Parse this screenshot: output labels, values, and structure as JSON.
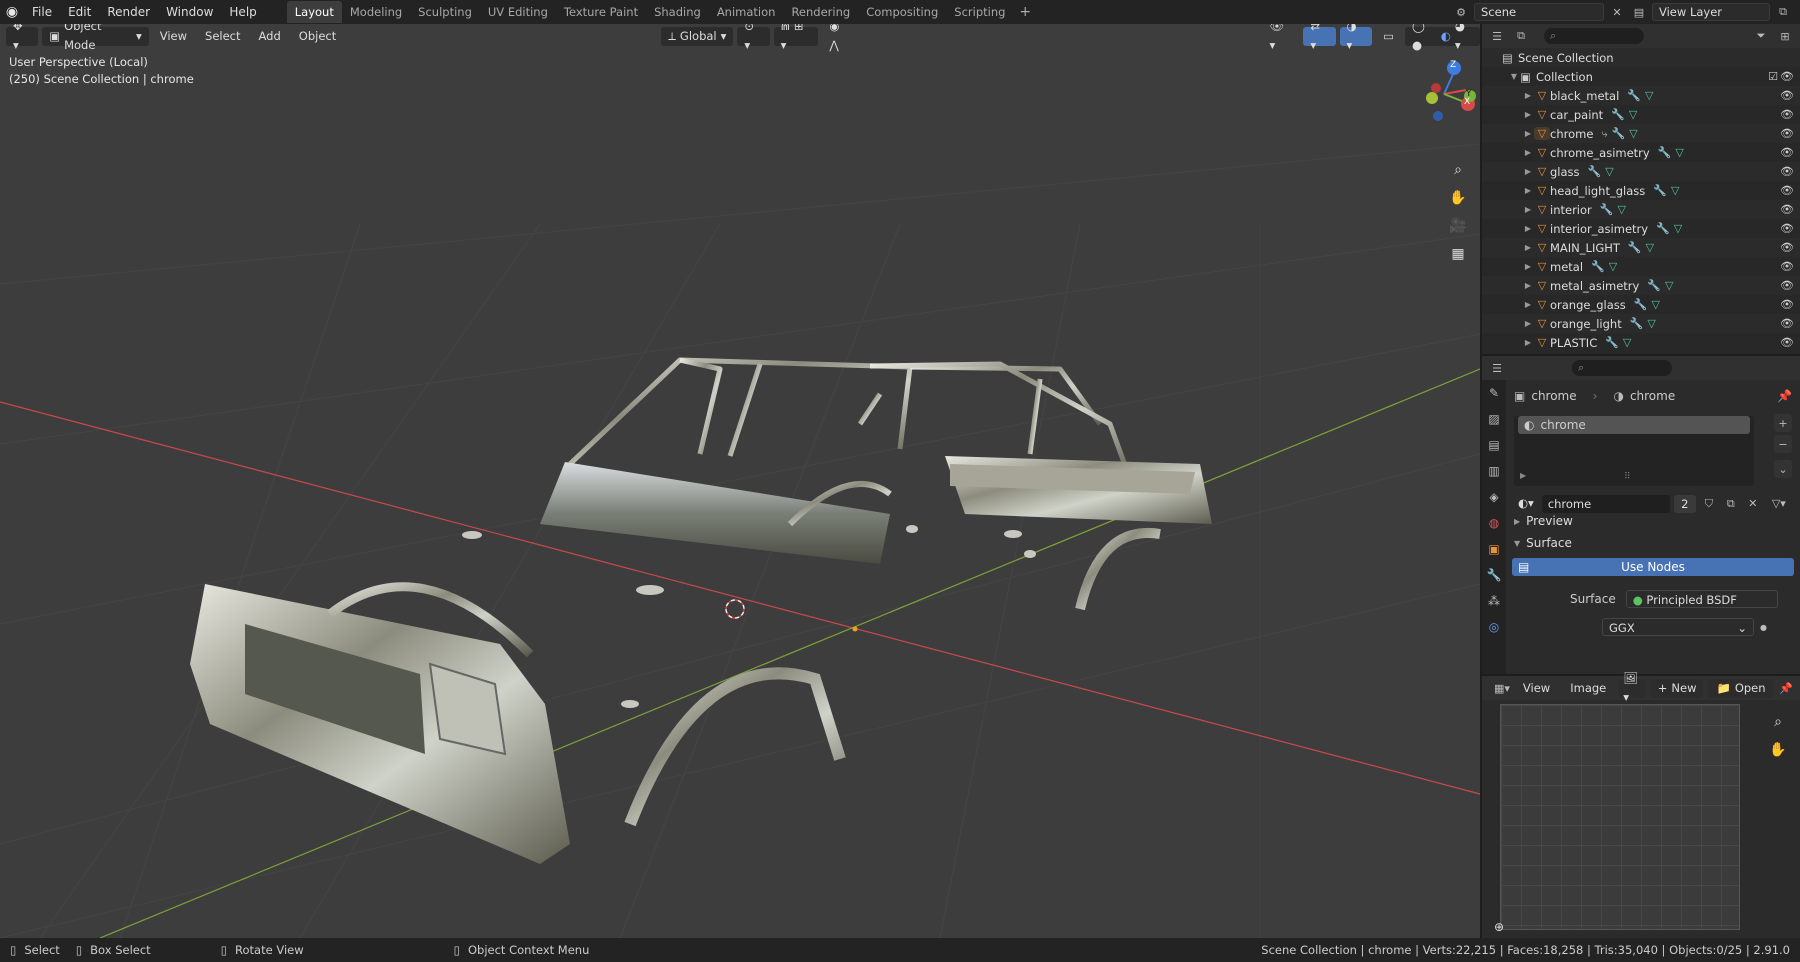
{
  "topbar": {
    "menus": [
      "File",
      "Edit",
      "Render",
      "Window",
      "Help"
    ],
    "tabs": [
      "Layout",
      "Modeling",
      "Sculpting",
      "UV Editing",
      "Texture Paint",
      "Shading",
      "Animation",
      "Rendering",
      "Compositing",
      "Scripting"
    ],
    "active_tab": "Layout",
    "scene": "Scene",
    "view_layer": "View Layer"
  },
  "viewport": {
    "mode": "Object Mode",
    "menus": [
      "View",
      "Select",
      "Add",
      "Object"
    ],
    "transform_orientation": "Global",
    "info_line1": "User Perspective (Local)",
    "info_line2": "(250) Scene Collection | chrome",
    "gizmo": {
      "x": "X",
      "y": "Y",
      "z": "Z"
    }
  },
  "outliner": {
    "root": "Scene Collection",
    "collection": "Collection",
    "items": [
      "black_metal",
      "car_paint",
      "chrome",
      "chrome_asimetry",
      "glass",
      "head_light_glass",
      "interior",
      "interior_asimetry",
      "MAIN_LIGHT",
      "metal",
      "metal_asimetry",
      "orange_glass",
      "orange_light",
      "PLASTIC"
    ]
  },
  "properties": {
    "object_name": "chrome",
    "material_name": "chrome",
    "slot_name": "chrome",
    "material_field": "chrome",
    "user_count": "2",
    "section_preview": "Preview",
    "section_surface": "Surface",
    "use_nodes_label": "Use Nodes",
    "surface_label": "Surface",
    "surface_value": "Principled BSDF",
    "distribution": "GGX"
  },
  "image_editor": {
    "menus": [
      "View",
      "Image"
    ],
    "new_label": "New",
    "open_label": "Open"
  },
  "statusbar": {
    "select": "Select",
    "box_select": "Box Select",
    "rotate_view": "Rotate View",
    "context_menu": "Object Context Menu",
    "stats": "Scene Collection | chrome | Verts:22,215 | Faces:18,258 | Tris:35,040 | Objects:0/25 | 2.91.0"
  },
  "colors": {
    "accent": "#4772b3",
    "active_tab": "#3d3d3d",
    "orange": "#e8923a"
  }
}
